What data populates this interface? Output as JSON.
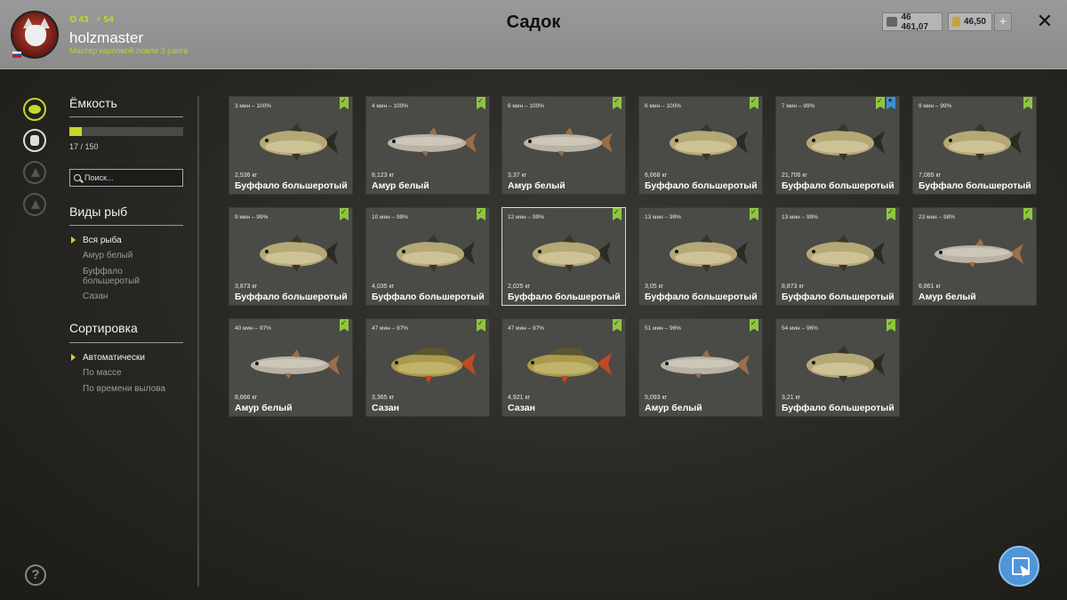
{
  "header": {
    "title": "Садок",
    "player": {
      "name": "holzmaster",
      "level": "43",
      "energy": "54",
      "rank": "Мастер карповой ловли 3 ранга"
    },
    "silver": "46 461,07",
    "gold": "46,50"
  },
  "sidebar": {
    "capacity_title": "Ёмкость",
    "capacity_text": "17 / 150",
    "capacity_fraction": 0.113,
    "search_placeholder": "Поиск...",
    "species_title": "Виды рыб",
    "species": [
      {
        "label": "Вся рыба",
        "selected": true
      },
      {
        "label": "Амур белый",
        "selected": false
      },
      {
        "label": "Буффало большеротый",
        "selected": false
      },
      {
        "label": "Сазан",
        "selected": false
      }
    ],
    "sort_title": "Сортировка",
    "sort": [
      {
        "label": "Автоматически",
        "selected": true
      },
      {
        "label": "По массе",
        "selected": false
      },
      {
        "label": "По времени вылова",
        "selected": false
      }
    ]
  },
  "fish": [
    {
      "meta": "3 мин – 100%",
      "weight": "2,536 кг",
      "name": "Буффало большеротый",
      "kind": "buffalo",
      "badges": [
        "green"
      ]
    },
    {
      "meta": "4 мин – 100%",
      "weight": "8,123 кг",
      "name": "Амур белый",
      "kind": "amur",
      "badges": [
        "green"
      ]
    },
    {
      "meta": "6 мин – 100%",
      "weight": "3,37 кг",
      "name": "Амур белый",
      "kind": "amur",
      "badges": [
        "green"
      ]
    },
    {
      "meta": "6 мин – 100%",
      "weight": "6,668 кг",
      "name": "Буффало большеротый",
      "kind": "buffalo",
      "badges": [
        "green"
      ]
    },
    {
      "meta": "7 мин – 99%",
      "weight": "21,706 кг",
      "name": "Буффало большеротый",
      "kind": "buffalo",
      "badges": [
        "green",
        "blue"
      ]
    },
    {
      "meta": "9 мин – 99%",
      "weight": "7,085 кг",
      "name": "Буффало большеротый",
      "kind": "buffalo",
      "badges": [
        "green"
      ]
    },
    {
      "meta": "9 мин – 99%",
      "weight": "3,873 кг",
      "name": "Буффало большеротый",
      "kind": "buffalo",
      "badges": [
        "green"
      ]
    },
    {
      "meta": "10 мин – 99%",
      "weight": "4,035 кг",
      "name": "Буффало большеротый",
      "kind": "buffalo",
      "badges": [
        "green"
      ]
    },
    {
      "meta": "12 мин – 99%",
      "weight": "2,025 кг",
      "name": "Буффало большеротый",
      "kind": "buffalo",
      "badges": [
        "green"
      ],
      "selected": true
    },
    {
      "meta": "13 мин – 99%",
      "weight": "3,05 кг",
      "name": "Буффало большеротый",
      "kind": "buffalo",
      "badges": [
        "green"
      ]
    },
    {
      "meta": "13 мин – 99%",
      "weight": "8,873 кг",
      "name": "Буффало большеротый",
      "kind": "buffalo",
      "badges": [
        "green"
      ]
    },
    {
      "meta": "23 мин – 98%",
      "weight": "6,861 кг",
      "name": "Амур белый",
      "kind": "amur",
      "badges": [
        "green"
      ]
    },
    {
      "meta": "40 мин – 97%",
      "weight": "8,666 кг",
      "name": "Амур белый",
      "kind": "amur",
      "badges": [
        "green"
      ]
    },
    {
      "meta": "47 мин – 97%",
      "weight": "3,365 кг",
      "name": "Сазан",
      "kind": "carp",
      "badges": [
        "green"
      ]
    },
    {
      "meta": "47 мин – 97%",
      "weight": "4,921 кг",
      "name": "Сазан",
      "kind": "carp",
      "badges": [
        "green"
      ]
    },
    {
      "meta": "51 мин – 96%",
      "weight": "5,093 кг",
      "name": "Амур белый",
      "kind": "amur",
      "badges": [
        "green"
      ]
    },
    {
      "meta": "54 мин – 96%",
      "weight": "3,21 кг",
      "name": "Буффало большеротый",
      "kind": "buffalo",
      "badges": [
        "green"
      ]
    }
  ],
  "colors": {
    "accent": "#c8d62a",
    "badge_green": "#8fc541",
    "badge_blue": "#3d8fd8"
  }
}
